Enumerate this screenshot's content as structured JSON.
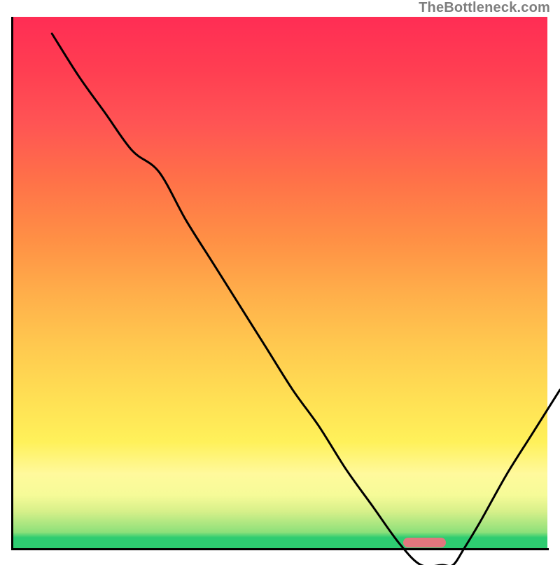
{
  "attribution": "TheBottleneck.com",
  "colors": {
    "gradient_top": "#ff2d54",
    "gradient_mid": "#ffe054",
    "gradient_bottom": "#2ecc71",
    "curve": "#000000",
    "marker": "#e2777e",
    "axis": "#000000",
    "attribution_text": "#7e7e7e"
  },
  "chart_data": {
    "type": "line",
    "title": "",
    "xlabel": "",
    "ylabel": "",
    "xlim": [
      0,
      100
    ],
    "ylim": [
      0,
      100
    ],
    "grid": false,
    "legend": false,
    "background": "vertical gradient red→yellow→green (top→bottom)",
    "series": [
      {
        "name": "bottleneck-curve",
        "x": [
          5,
          10,
          15,
          20,
          25,
          30,
          35,
          40,
          45,
          50,
          55,
          60,
          65,
          70,
          74,
          78,
          80,
          82,
          85,
          90,
          95,
          100
        ],
        "values": [
          100,
          92,
          85,
          78,
          74,
          65,
          57,
          49,
          41,
          33,
          26,
          18,
          11,
          4,
          0,
          0,
          0,
          3,
          8,
          17,
          25,
          33
        ]
      }
    ],
    "annotations": [
      {
        "name": "optimal-zone-marker",
        "shape": "rounded-bar",
        "x_range": [
          73,
          81
        ],
        "y": 1,
        "color": "#e2777e"
      }
    ]
  }
}
